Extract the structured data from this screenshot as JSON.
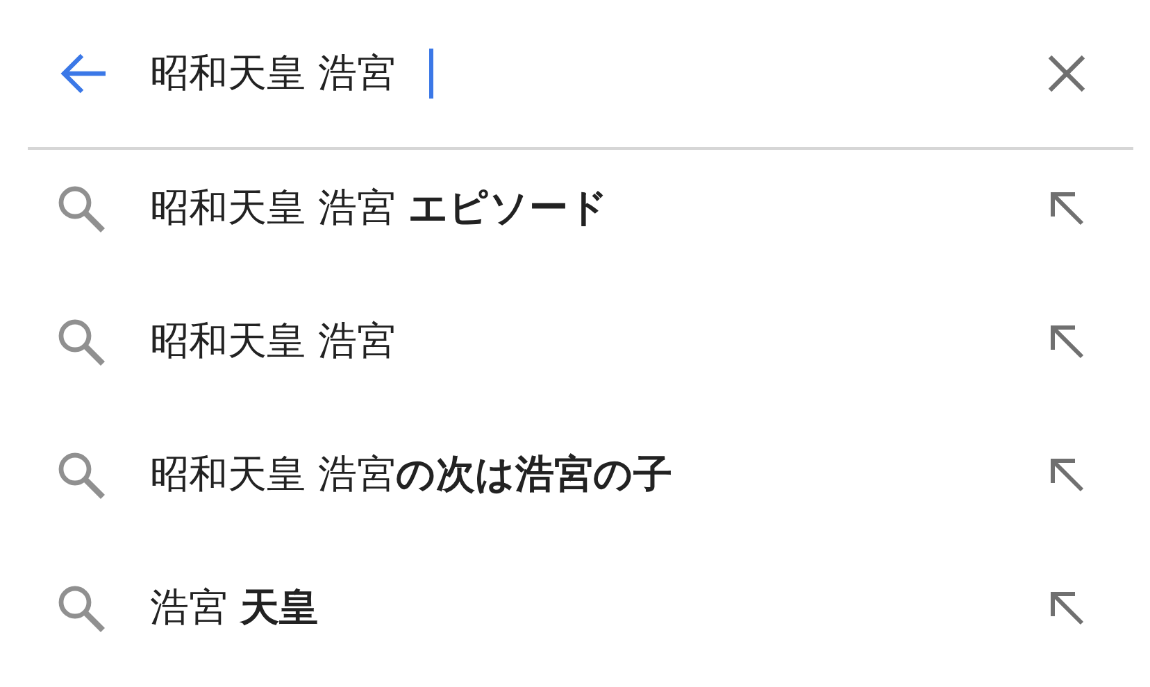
{
  "search_bar": {
    "query": "昭和天皇 浩宮"
  },
  "suggestions": [
    {
      "text": "昭和天皇 浩宮 **エピソード**"
    },
    {
      "text": "昭和天皇 浩宮"
    },
    {
      "text": "昭和天皇 浩宮**の次は浩宮の子**"
    },
    {
      "text": "浩宮 **天皇**"
    }
  ]
}
